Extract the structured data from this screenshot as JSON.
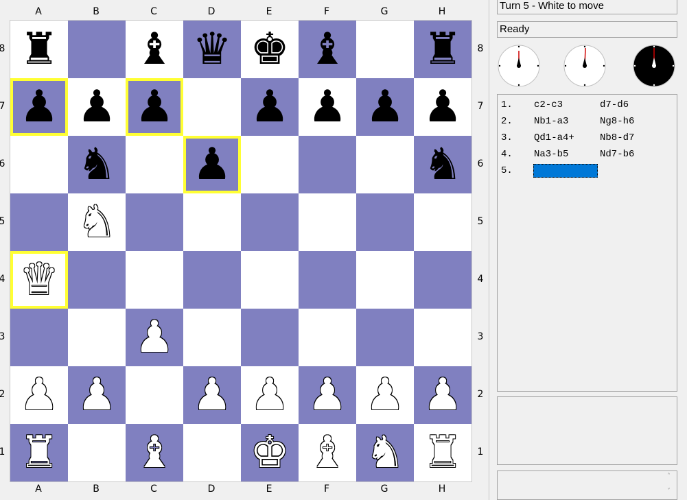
{
  "files": [
    "A",
    "B",
    "C",
    "D",
    "E",
    "F",
    "G",
    "H"
  ],
  "ranks": [
    "8",
    "7",
    "6",
    "5",
    "4",
    "3",
    "2",
    "1"
  ],
  "colors": {
    "light_square": "#ffffff",
    "dark_square": "#8080c0",
    "highlight": "#ffff33",
    "selection": "#0078d7"
  },
  "board": [
    [
      "bR",
      "",
      "bB",
      "bQ",
      "bK",
      "bB",
      "",
      "bR"
    ],
    [
      "bP",
      "bP",
      "bP",
      "",
      "bP",
      "bP",
      "bP",
      "bP"
    ],
    [
      "",
      "bN",
      "",
      "bP",
      "",
      "",
      "",
      "bN"
    ],
    [
      "",
      "wN",
      "",
      "",
      "",
      "",
      "",
      ""
    ],
    [
      "wQ",
      "",
      "",
      "",
      "",
      "",
      "",
      ""
    ],
    [
      "",
      "",
      "wP",
      "",
      "",
      "",
      "",
      ""
    ],
    [
      "wP",
      "wP",
      "",
      "wP",
      "wP",
      "wP",
      "wP",
      "wP"
    ],
    [
      "wR",
      "",
      "wB",
      "",
      "wK",
      "wB",
      "wN",
      "wR"
    ]
  ],
  "highlighted_squares": [
    "a7",
    "c7",
    "d6",
    "a4"
  ],
  "turn_status": "Turn 5 - White to move",
  "engine_status": "Ready",
  "moves": [
    {
      "num": "1.",
      "white": "c2-c3",
      "black": "d7-d6"
    },
    {
      "num": "2.",
      "white": "Nb1-a3",
      "black": "Ng8-h6"
    },
    {
      "num": "3.",
      "white": "Qd1-a4+",
      "black": "Nb8-d7"
    },
    {
      "num": "4.",
      "white": "Na3-b5",
      "black": "Nd7-b6"
    },
    {
      "num": "5.",
      "white": "",
      "black": ""
    }
  ],
  "icons": {
    "clocks": [
      "white-clock-icon",
      "total-clock-icon",
      "black-clock-icon"
    ],
    "scroll": [
      "scroll-up-icon",
      "scroll-down-icon"
    ]
  }
}
